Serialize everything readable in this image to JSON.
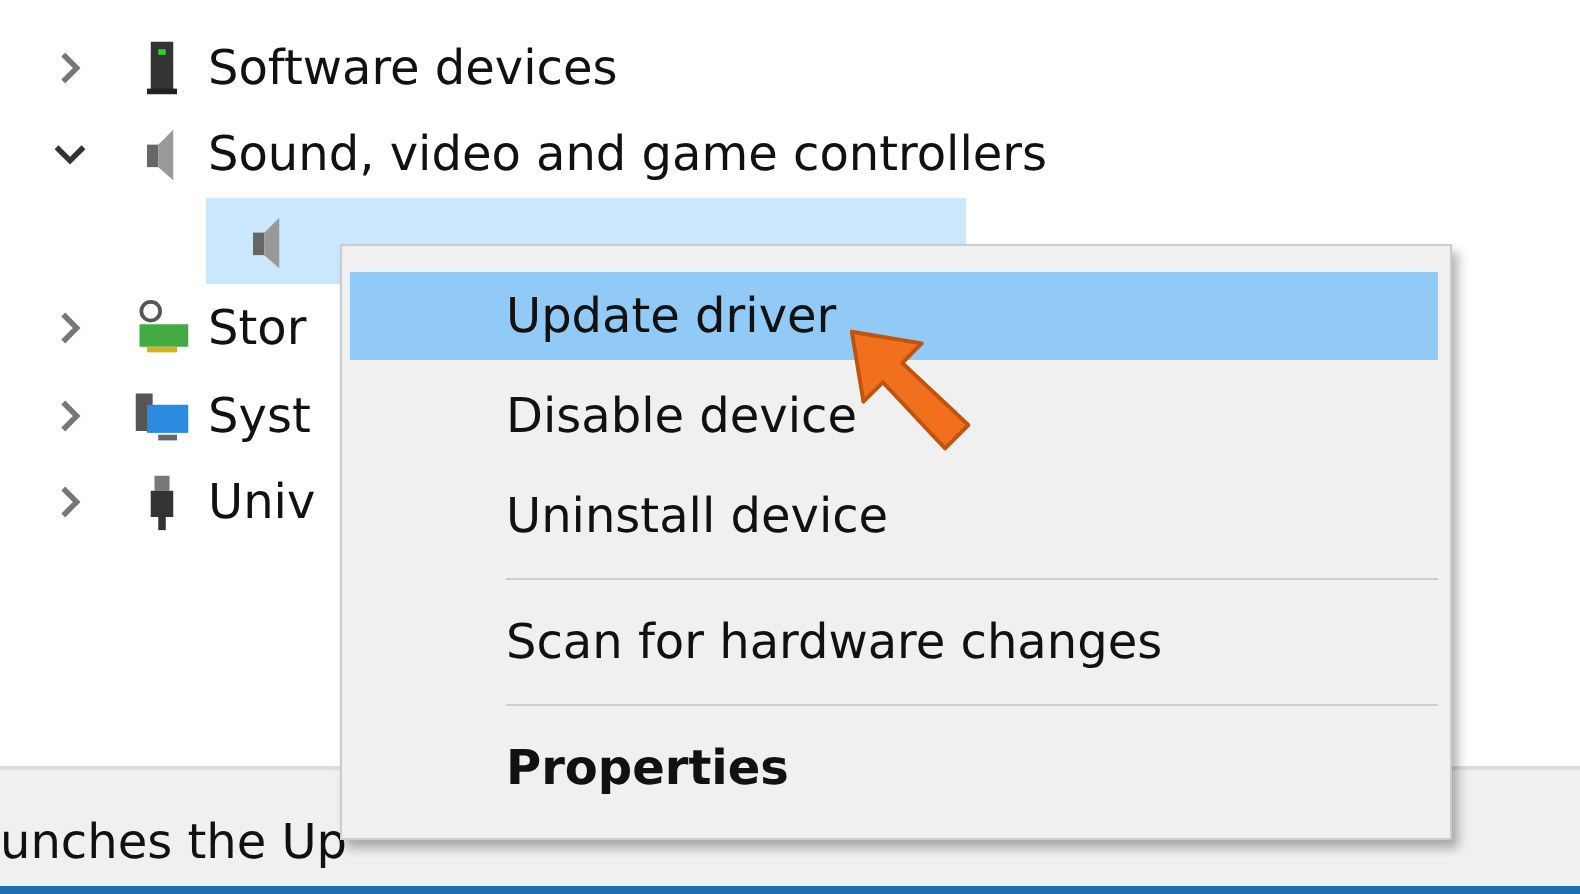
{
  "tree": [
    {
      "label": "Software devices",
      "kind": "box",
      "expanded": false,
      "selected": false
    },
    {
      "label": "Sound, video and game controllers",
      "kind": "speaker",
      "expanded": true,
      "selected": false,
      "children": [
        {
          "kind": "speaker",
          "selected": true
        }
      ]
    },
    {
      "label": "Stor",
      "kind": "storage",
      "expanded": false,
      "selected": false
    },
    {
      "label": "Syst",
      "kind": "monitor",
      "expanded": false,
      "selected": false
    },
    {
      "label": "Univ",
      "kind": "usb",
      "expanded": false,
      "selected": false
    }
  ],
  "context_menu": [
    {
      "kind": "item",
      "label": "Update driver",
      "selected": true,
      "default": false
    },
    {
      "kind": "item",
      "label": "Disable device",
      "selected": false,
      "default": false
    },
    {
      "kind": "item",
      "label": "Uninstall device",
      "selected": false,
      "default": false
    },
    {
      "kind": "separator"
    },
    {
      "kind": "item",
      "label": "Scan for hardware changes",
      "selected": false,
      "default": false
    },
    {
      "kind": "separator"
    },
    {
      "kind": "item",
      "label": "Properties",
      "selected": false,
      "default": true
    }
  ],
  "status_bar": {
    "text": "unches the Up"
  }
}
